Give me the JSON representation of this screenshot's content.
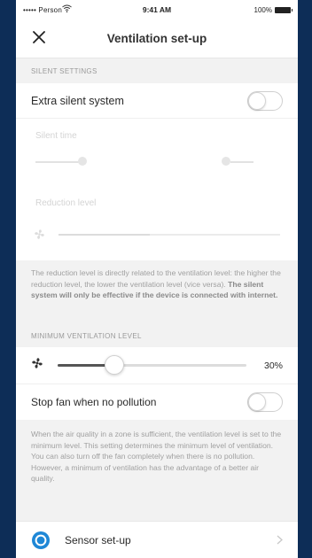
{
  "status_bar": {
    "carrier": "••••• Person",
    "time": "9:41 AM",
    "battery": "100%"
  },
  "header": {
    "title": "Ventilation set-up",
    "close_icon": "close-icon"
  },
  "silent_settings": {
    "section_label": "SILENT SETTINGS",
    "extra_silent_label": "Extra silent system",
    "extra_silent_on": false,
    "disabled_label_1": "Silent time",
    "disabled_value_left": "",
    "disabled_value_right": "",
    "disabled_label_2": "Reduction level",
    "disabled_percent": "",
    "info_text_plain": "The reduction level is directly related to the ventilation level: the higher the reduction level, the lower the ventilation level (vice versa). ",
    "info_text_bold": "The silent system will only be effective if the device is connected with internet."
  },
  "minimum_ventilation": {
    "section_label": "MINIMUM VENTILATION LEVEL",
    "fan_icon": "fan-icon",
    "level_percent": "30%",
    "level_value": 0.3,
    "stop_fan_label": "Stop fan when no pollution",
    "stop_fan_on": false,
    "info_text": "When the air quality in a zone is sufficient, the ventilation level is set to the minimum level. This setting determines the minimum level of ventilation. You can also turn off the fan completely when there is no pollution. However, a minimum of ventilation has the advantage of a better air quality."
  },
  "sensor_row": {
    "label": "Sensor set-up",
    "icon": "sensor-icon"
  },
  "colors": {
    "accent": "#1e87d6",
    "background": "#f2f2f2",
    "frame": "#0d2d57"
  }
}
